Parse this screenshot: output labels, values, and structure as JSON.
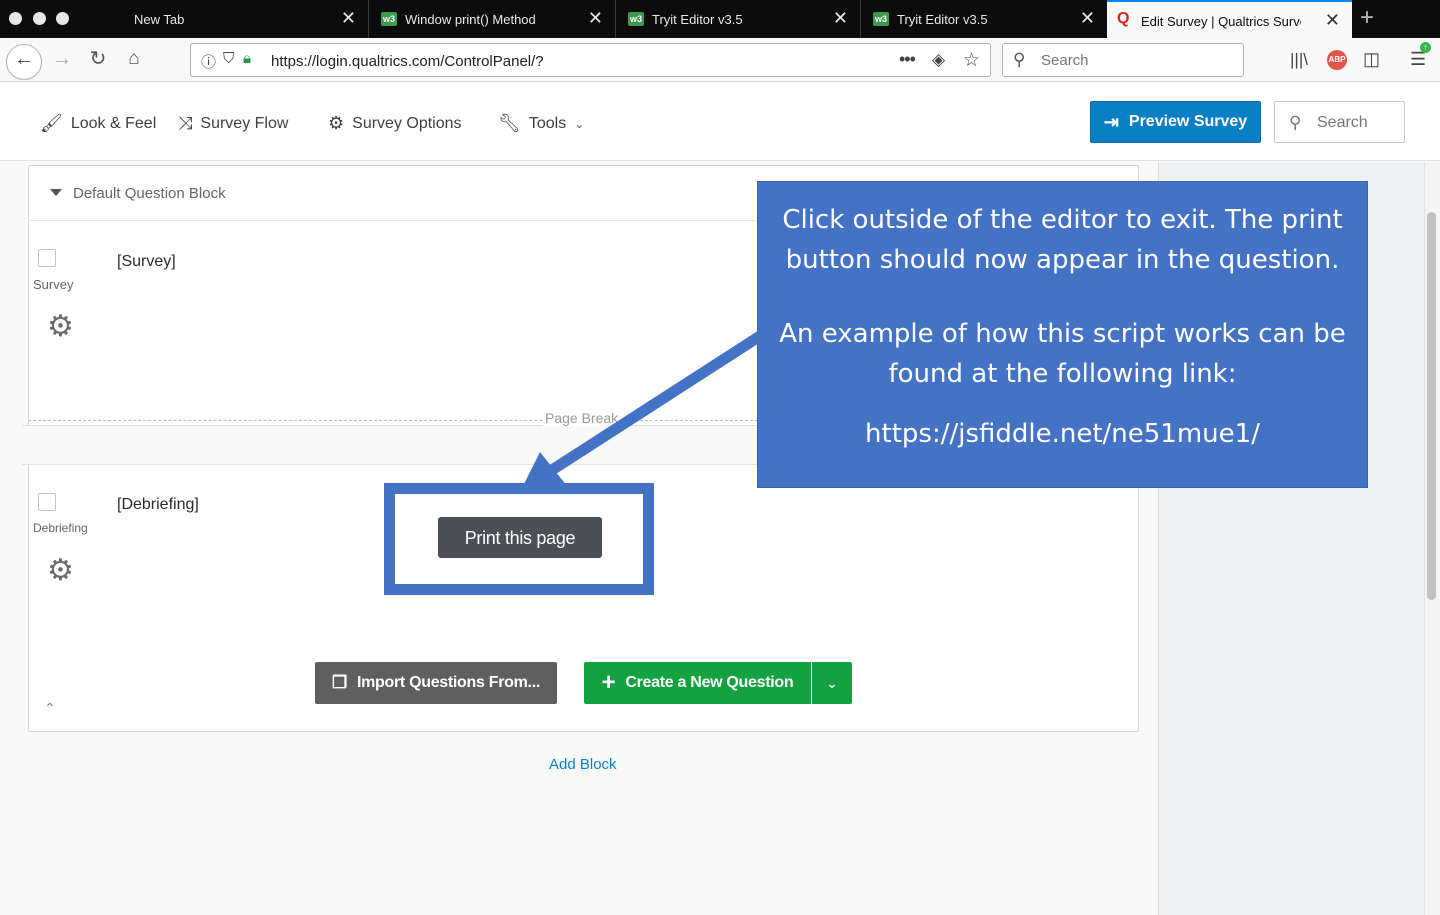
{
  "browser": {
    "tabs": [
      {
        "title": "New Tab",
        "favicon": ""
      },
      {
        "title": "Window print() Method",
        "favicon": "w3"
      },
      {
        "title": "Tryit Editor v3.5",
        "favicon": "w3"
      },
      {
        "title": "Tryit Editor v3.5",
        "favicon": "w3"
      },
      {
        "title": "Edit Survey | Qualtrics Survey",
        "favicon": "Q",
        "active": true
      }
    ],
    "url": "https://login.qualtrics.com/ControlPanel/?",
    "search_placeholder": "Search"
  },
  "toolbar": {
    "look_feel": "Look & Feel",
    "survey_flow": "Survey Flow",
    "survey_options": "Survey Options",
    "tools": "Tools",
    "preview": "Preview Survey",
    "search_placeholder": "Search"
  },
  "block": {
    "header": "Default Question Block",
    "page_break": "Page Break",
    "questions": [
      {
        "label": "Survey",
        "text": "[Survey]"
      },
      {
        "label": "Debriefing",
        "text": "[Debriefing]"
      }
    ],
    "print_button": "Print this page",
    "import_button": "Import Questions From...",
    "create_button": "Create a New Question",
    "add_block": "Add Block"
  },
  "callout": {
    "line1": "Click outside of the editor to exit. The print button should now appear in the question.",
    "line2": "An example of how this script works can be found at the following link:",
    "link": "https://jsfiddle.net/ne51mue1/"
  },
  "colors": {
    "callout": "#4472c4",
    "preview": "#0b7fc6",
    "create": "#14a142",
    "import": "#5f5f5f",
    "print": "#4b4f56"
  }
}
